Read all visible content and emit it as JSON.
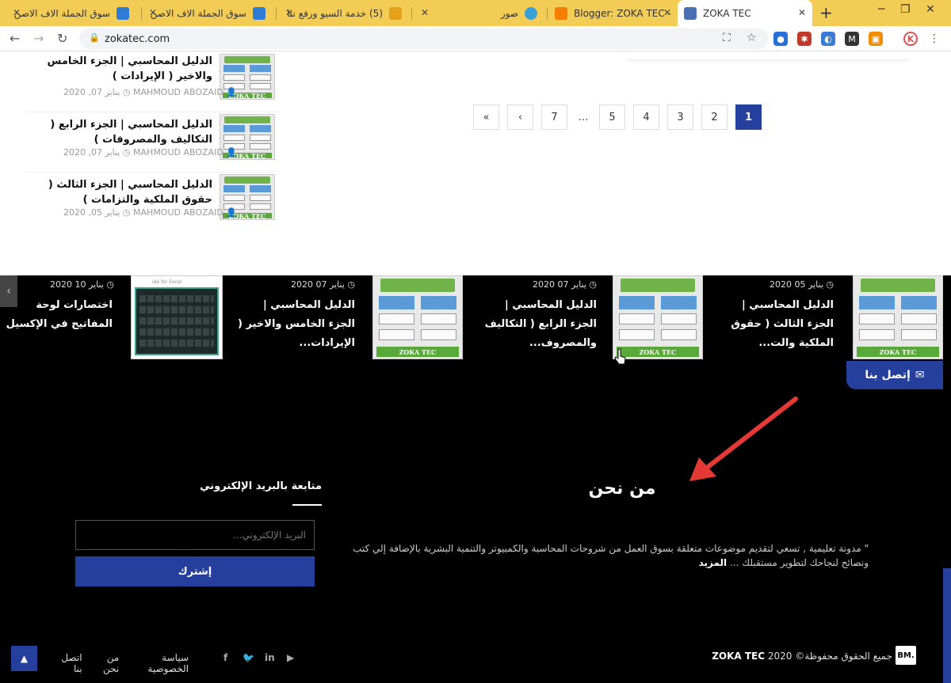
{
  "browser": {
    "tabs": [
      {
        "title": "سوق الجملة الاف الاصن",
        "icon": "jomla-icon",
        "color": "#2e7bd6"
      },
      {
        "title": "سوق الجملة الاف الاصن",
        "icon": "jomla-icon",
        "color": "#2e7bd6"
      },
      {
        "title": "(5) خدمة السيو ورفع نتا",
        "icon": "five-icon",
        "color": "#e4a21a"
      },
      {
        "title": "صور",
        "icon": "photos-icon",
        "color": "#3aa0d8"
      },
      {
        "title": "Blogger: ZOKA TEC - ك",
        "icon": "blogger-icon",
        "color": "#f57d00"
      },
      {
        "title": "ZOKA TEC",
        "icon": "zokatec-icon",
        "color": "#4a6fb5"
      }
    ],
    "url": "zokatec.com"
  },
  "pagination": {
    "prev_first": "«",
    "prev": "‹",
    "pages": [
      "7",
      "…",
      "5",
      "4",
      "3",
      "2",
      "1"
    ],
    "active": "1"
  },
  "side_posts": [
    {
      "title": "الدليل المحاسبي | الجزء الخامس والاخير ( الإيرادات )",
      "author": "MAHMOUD ABOZAID",
      "date": "يناير 07, 2020",
      "thumb_footer": "ZOKA TEC"
    },
    {
      "title": "الدليل المحاسبي | الجزء الرابع ( التكاليف والمصروفات )",
      "author": "MAHMOUD ABOZAID",
      "date": "يناير 07, 2020",
      "thumb_footer": "ZOKA TEC"
    },
    {
      "title": "الدليل المحاسبي | الجزء الثالث ( حقوق الملكية والتزامات )",
      "author": "MAHMOUD ABOZAID",
      "date": "يناير 05, 2020",
      "thumb_footer": "ZOKA TEC"
    }
  ],
  "slider": [
    {
      "date": "يناير 05 2020",
      "title": "الدليل المحاسبي | الجزء الثالث ( حقوق الملكية والت...",
      "thumb": "ZOKA TEC"
    },
    {
      "date": "يناير 07 2020",
      "title": "الدليل المحاسبي | الجزء الرابع ( التكاليف والمصروف...",
      "thumb": "ZOKA TEC"
    },
    {
      "date": "يناير 07 2020",
      "title": "الدليل المحاسبي | الجزء الخامس والاخير ( الإيرادات...",
      "thumb": "ZOKA TEC"
    },
    {
      "date": "يناير 10 2020",
      "title": "اختصارات لوحة المفاتيح في الإكسيل",
      "thumb": "ide for Excel"
    }
  ],
  "contact_button": "إتصل بنا",
  "about": {
    "title": "من نحن",
    "text": "\" مدونة تعليمية , تسعي لتقديم موضوعات متعلقة بسوق العمل من شروحات المحاسبة والكمبيوتر والتنمية البشرية بالإضافة إلي كتب ونصائح لنجاحك لتطوير مستقبلك ...",
    "more": "المزيد"
  },
  "subscribe": {
    "title": "متابعة بالبريد الإلكتروني",
    "placeholder": "البريد الإلكتروني...",
    "button": "إشترك"
  },
  "footer": {
    "copyright": "جميع الحقوق محفوظة© 2020",
    "brand": "ZOKA TEC",
    "logo": "BM.",
    "links": [
      "سياسة الخصوصية",
      "من نحن",
      "اتصل بنا"
    ],
    "social": [
      "facebook-icon",
      "twitter-icon",
      "linkedin-icon",
      "youtube-icon"
    ]
  },
  "colors": {
    "accent": "#253f9c",
    "tabbar": "#f2cc55",
    "annotation_arrow": "#e53935"
  }
}
